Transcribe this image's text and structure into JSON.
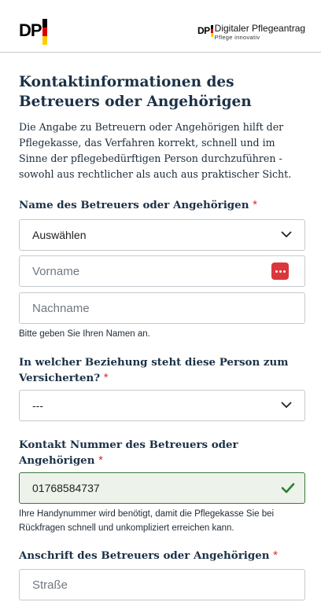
{
  "header": {
    "logo_text": "DP",
    "brand_title": "Digitaler Pflegeantrag",
    "brand_subtitle": "Pflege innovativ"
  },
  "section": {
    "title": "Kontaktinformationen des Betreuers oder Angehörigen",
    "intro": "Die Angabe zu Betreuern oder Angehörigen hilft der Pflegekasse, das Verfahren korrekt, schnell und im Sinne der pflegebedürftigen Person durchzuführen - sowohl aus rechtlicher als auch aus praktischer Sicht."
  },
  "name_group": {
    "label": "Name des Betreuers oder Angehörigen",
    "required_mark": "*",
    "salutation_value": "Auswählen",
    "firstname_placeholder": "Vorname",
    "lastname_placeholder": "Nachname",
    "hint": "Bitte geben Sie Ihren Namen an."
  },
  "relation_group": {
    "label": "In welcher Beziehung steht diese Person zum Versicherten?",
    "required_mark": "*",
    "select_value": "---"
  },
  "phone_group": {
    "label": "Kontakt Nummer des Betreuers oder Angehörigen",
    "required_mark": "*",
    "value": "01768584737",
    "hint": "Ihre Handynummer wird benötigt, damit die Pflegekasse Sie bei Rückfragen schnell und unkompliziert erreichen kann."
  },
  "address_group": {
    "label": "Anschrift des Betreuers oder Angehörigen",
    "required_mark": "*",
    "street_placeholder": "Straße"
  },
  "colors": {
    "required": "#d0312d",
    "valid_border": "#3a7a3a",
    "valid_bg": "#edf3ea",
    "check": "#2e7d32"
  }
}
